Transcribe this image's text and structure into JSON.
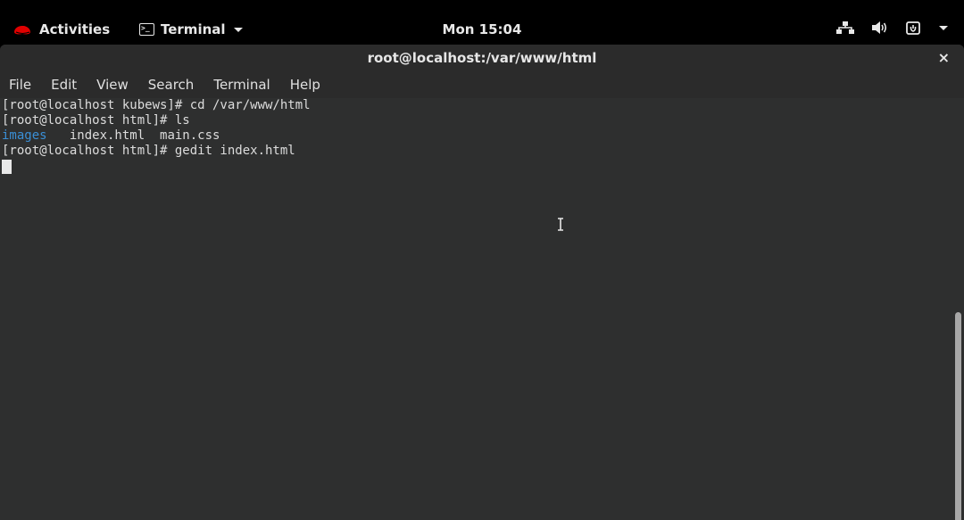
{
  "topbar": {
    "activities_label": "Activities",
    "app_label": "Terminal",
    "clock": "Mon 15:04",
    "status_icons": [
      "network-icon",
      "volume-icon",
      "power-icon",
      "chevron-down-icon"
    ]
  },
  "window": {
    "title": "root@localhost:/var/www/html",
    "close_glyph": "×"
  },
  "menubar": {
    "items": [
      "File",
      "Edit",
      "View",
      "Search",
      "Terminal",
      "Help"
    ]
  },
  "terminal": {
    "lines": [
      "[root@localhost kubews]# cd /var/www/html",
      "[root@localhost html]# ls",
      {
        "dir": "images",
        "rest": "   index.html  main.css"
      },
      "[root@localhost html]# gedit index.html"
    ],
    "line0": "[root@localhost kubews]# cd /var/www/html",
    "line1": "[root@localhost html]# ls",
    "line2_dir": "images",
    "line2_rest": "   index.html  main.css",
    "line3": "[root@localhost html]# gedit index.html",
    "dir_color": "#3a8fd6"
  },
  "colors": {
    "terminal_bg": "#2e2f2f",
    "topbar_bg": "#000000",
    "redhat_red": "#e00000"
  }
}
